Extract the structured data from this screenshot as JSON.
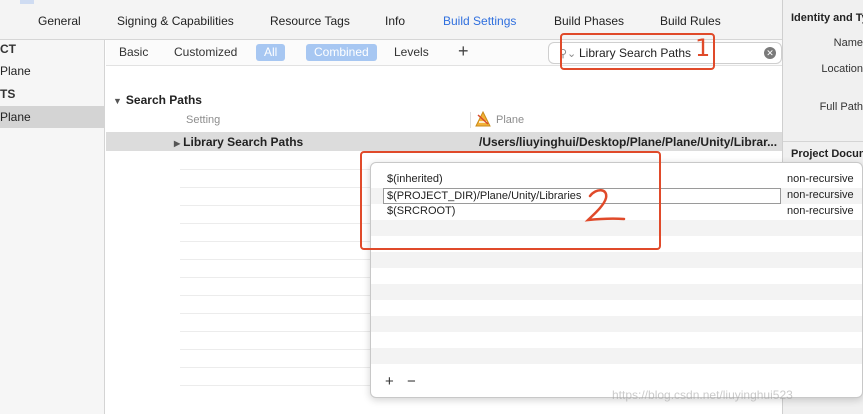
{
  "tabs": [
    {
      "label": "General",
      "active": false
    },
    {
      "label": "Signing & Capabilities",
      "active": false
    },
    {
      "label": "Resource Tags",
      "active": false
    },
    {
      "label": "Info",
      "active": false
    },
    {
      "label": "Build Settings",
      "active": true
    },
    {
      "label": "Build Phases",
      "active": false
    },
    {
      "label": "Build Rules",
      "active": false
    }
  ],
  "navigator": {
    "project_header": "CT",
    "project_item": "Plane",
    "targets_header": "TS",
    "target_item": "Plane"
  },
  "filter_bar": {
    "basic": "Basic",
    "customized": "Customized",
    "all": "All",
    "combined": "Combined",
    "levels": "Levels",
    "add": "+"
  },
  "search": {
    "value": "Library Search Paths",
    "icon": "magnifier-icon"
  },
  "annotations": {
    "mark1": "1",
    "mark2": "2"
  },
  "settings": {
    "section_title": "Search Paths",
    "col_setting": "Setting",
    "col_target": "Plane",
    "row": {
      "name": "Library Search Paths",
      "value": "/Users/liuyinghui/Desktop/Plane/Plane/Unity/Librar..."
    }
  },
  "popover": {
    "entries": [
      {
        "path": "$(inherited)",
        "mode": "non-recursive"
      },
      {
        "path": "$(PROJECT_DIR)/Plane/Unity/Libraries",
        "mode": "non-recursive",
        "editing": true
      },
      {
        "path": "$(SRCROOT)",
        "mode": "non-recursive"
      }
    ],
    "add_label": "+",
    "remove_label": "−"
  },
  "inspector": {
    "title": "Identity and Ty",
    "name_label": "Name",
    "location_label": "Location",
    "full_path_label": "Full Path",
    "section": "Project Docum"
  },
  "watermark": "https://blog.csdn.net/liuyinghui523",
  "colors": {
    "accent": "#2f6fde",
    "annotation": "#e04a2a",
    "pill": "#a7c7f2"
  }
}
